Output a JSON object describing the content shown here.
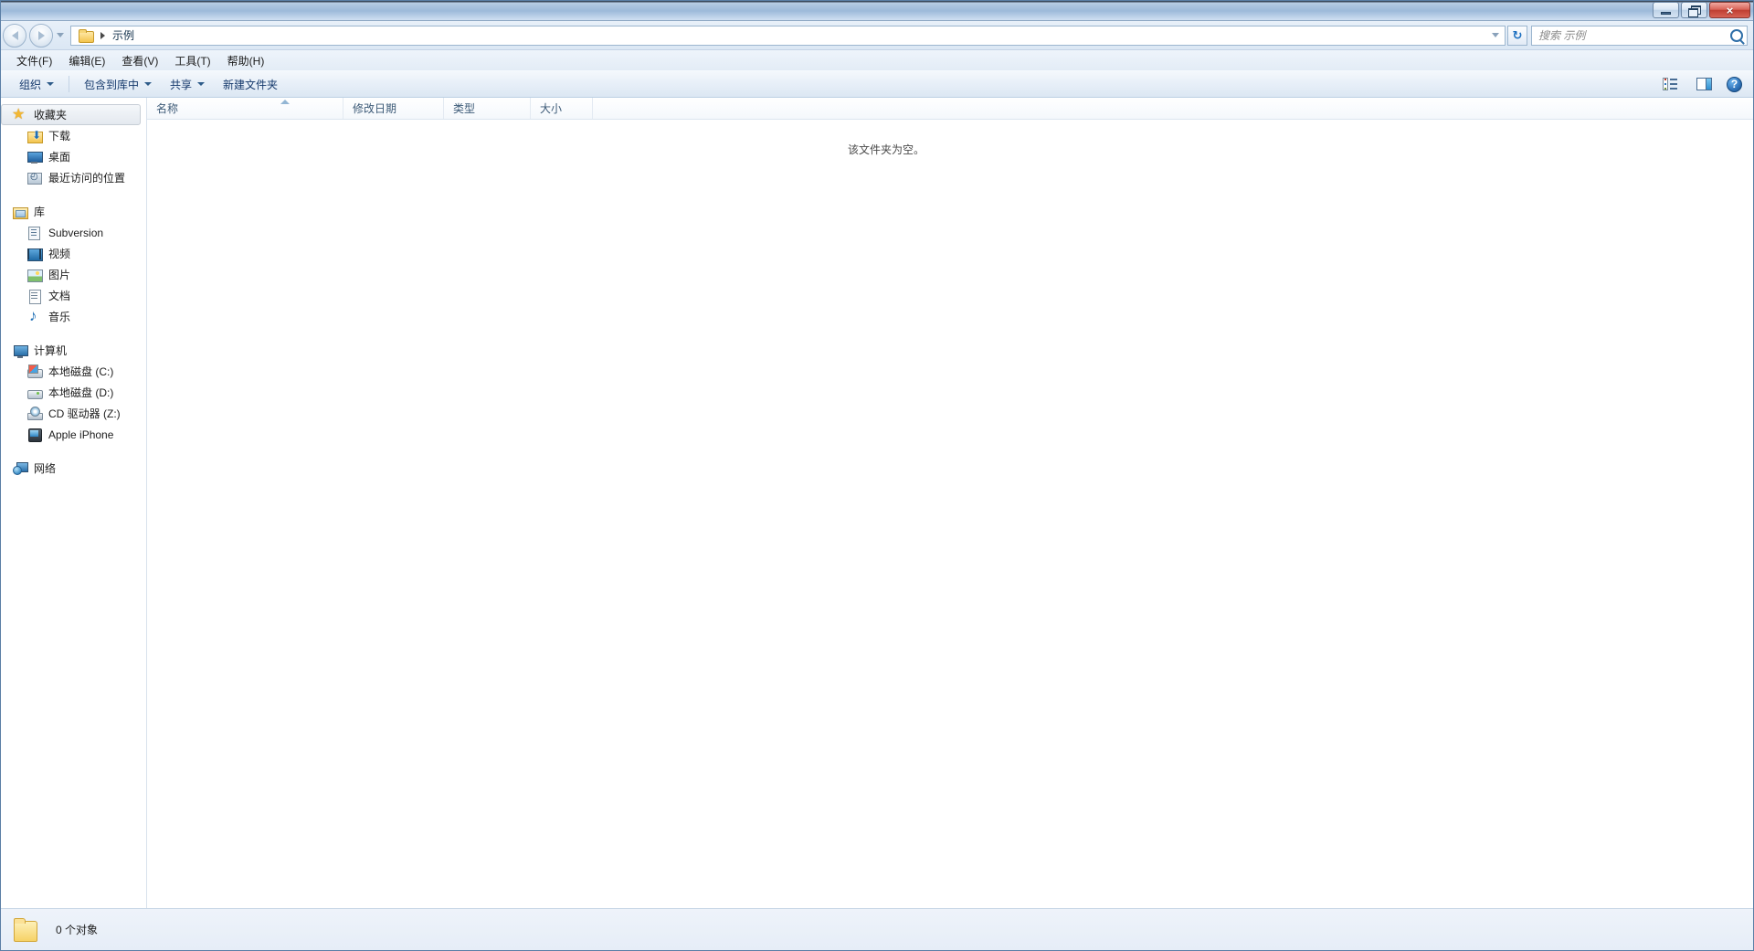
{
  "window": {
    "controls": {
      "minimize_label": "最小化",
      "restore_label": "还原",
      "close_label": "×"
    }
  },
  "address_bar": {
    "back_label": "后退",
    "forward_label": "前进",
    "recent_pages_label": "最近访问的页面",
    "path_icon": "folder-icon",
    "crumb": "示例",
    "separator": "▶",
    "refresh_glyph": "↻",
    "refresh_label": "刷新"
  },
  "search": {
    "placeholder": "搜索 示例",
    "value": ""
  },
  "menu": {
    "items": [
      {
        "label": "文件(F)",
        "name": "menu-file"
      },
      {
        "label": "编辑(E)",
        "name": "menu-edit"
      },
      {
        "label": "查看(V)",
        "name": "menu-view"
      },
      {
        "label": "工具(T)",
        "name": "menu-tools"
      },
      {
        "label": "帮助(H)",
        "name": "menu-help"
      }
    ]
  },
  "toolbar": {
    "organize_label": "组织",
    "include_in_library_label": "包含到库中",
    "share_label": "共享",
    "new_folder_label": "新建文件夹",
    "view_options_label": "更改您的视图",
    "preview_pane_label": "显示预览窗格",
    "help_label": "?"
  },
  "nav_pane": {
    "groups": [
      {
        "name": "favorites",
        "root": {
          "label": "收藏夹",
          "icon": "star-icon",
          "selected": true
        },
        "children": [
          {
            "label": "下载",
            "icon": "downloads-icon"
          },
          {
            "label": "桌面",
            "icon": "desktop-icon"
          },
          {
            "label": "最近访问的位置",
            "icon": "recent-places-icon"
          }
        ]
      },
      {
        "name": "libraries",
        "root": {
          "label": "库",
          "icon": "library-icon",
          "selected": false
        },
        "children": [
          {
            "label": "Subversion",
            "icon": "subversion-icon"
          },
          {
            "label": "视频",
            "icon": "video-icon"
          },
          {
            "label": "图片",
            "icon": "pictures-icon"
          },
          {
            "label": "文档",
            "icon": "documents-icon"
          },
          {
            "label": "音乐",
            "icon": "music-icon"
          }
        ]
      },
      {
        "name": "computer",
        "root": {
          "label": "计算机",
          "icon": "computer-icon",
          "selected": false
        },
        "children": [
          {
            "label": "本地磁盘 (C:)",
            "icon": "system-drive-icon"
          },
          {
            "label": "本地磁盘 (D:)",
            "icon": "hard-drive-icon"
          },
          {
            "label": "CD 驱动器 (Z:)",
            "icon": "cd-drive-icon"
          },
          {
            "label": "Apple iPhone",
            "icon": "iphone-icon"
          }
        ]
      },
      {
        "name": "network",
        "root": {
          "label": "网络",
          "icon": "network-icon",
          "selected": false
        },
        "children": []
      }
    ]
  },
  "file_list": {
    "columns": [
      {
        "label": "名称",
        "name": "column-name",
        "sorted": "asc"
      },
      {
        "label": "修改日期",
        "name": "column-date-modified",
        "sorted": ""
      },
      {
        "label": "类型",
        "name": "column-type",
        "sorted": ""
      },
      {
        "label": "大小",
        "name": "column-size",
        "sorted": ""
      }
    ],
    "rows": [],
    "empty_message": "该文件夹为空。"
  },
  "status_bar": {
    "item_count_text": "0 个对象",
    "folder_icon": "folder-icon"
  },
  "colors": {
    "title_bar_top": "#b9cde4",
    "title_bar_bottom": "#e4eef8",
    "accent_blue": "#2f72b8",
    "close_red": "#bf3f32",
    "selection_border": "#c7ced6"
  }
}
